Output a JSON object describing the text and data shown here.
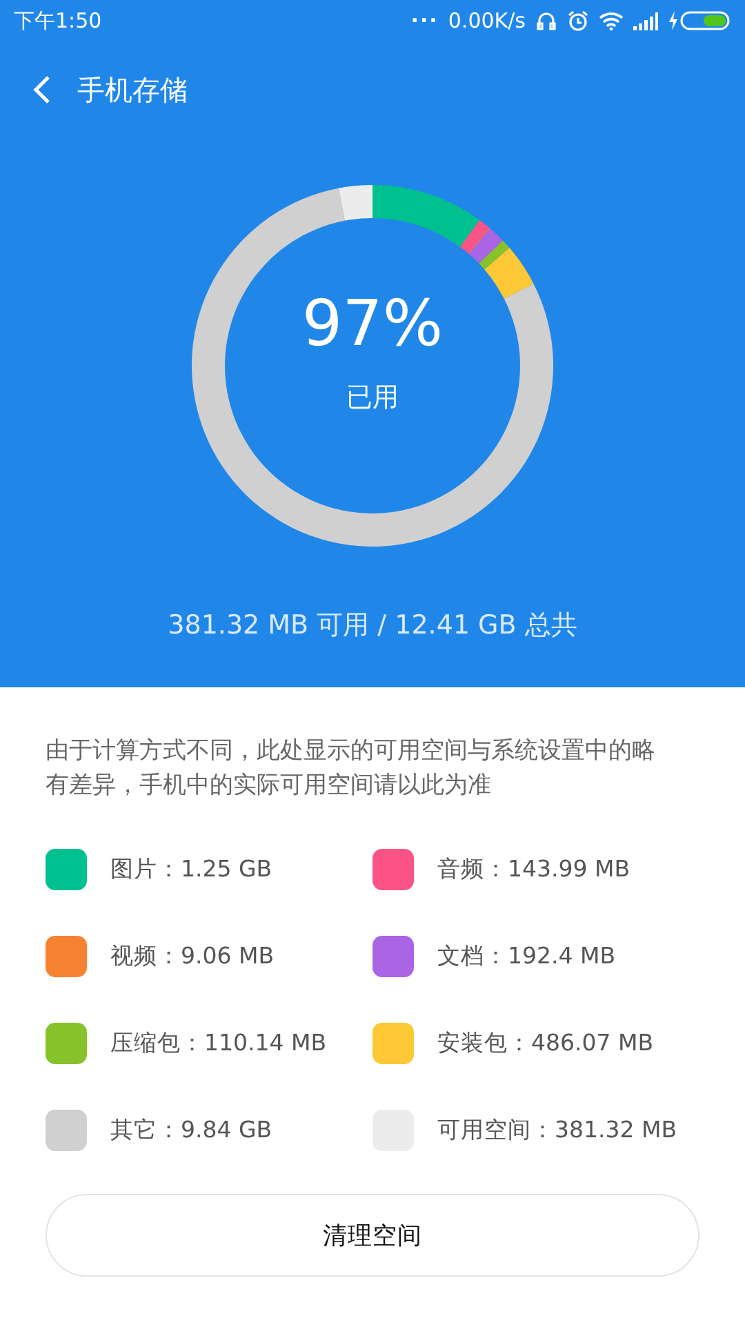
{
  "status_bar": {
    "time": "下午1:50",
    "dots": "...",
    "speed": "0.00K/s"
  },
  "header": {
    "title": "手机存储"
  },
  "usage": {
    "percent": "97%",
    "caption": "已用",
    "summary": "381.32 MB 可用 / 12.41 GB 总共",
    "chart_data": {
      "type": "donut",
      "categories": [
        "图片：1.25 GB",
        "音频：143.99 MB",
        "视频：9.06 MB",
        "文档：192.4 MB",
        "压缩包：110.14 MB",
        "安装包：486.07 MB",
        "其它：9.84 GB",
        "可用空间：381.32 MB"
      ],
      "values": [
        1280,
        143.99,
        9.06,
        192.4,
        110.14,
        486.07,
        10076,
        381.32
      ]
    }
  },
  "legend": [
    {
      "color": "#00c08f"
    },
    {
      "color": "#fb5386"
    },
    {
      "color": "#f58231"
    },
    {
      "color": "#a965e3"
    },
    {
      "color": "#86c22a"
    },
    {
      "color": "#fdc835"
    },
    {
      "color": "#d0d0d0"
    },
    {
      "color": "#ececec"
    }
  ],
  "note": "由于计算方式不同，此处显示的可用空间与系统设置中的略有差异，手机中的实际可用空间请以此为准",
  "button": {
    "label": "清理空间"
  }
}
